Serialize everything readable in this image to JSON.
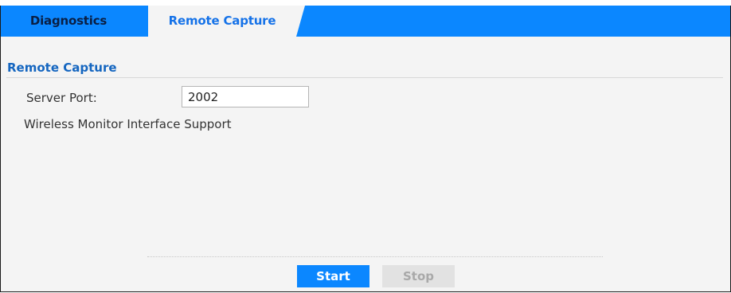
{
  "tabs": [
    {
      "label": "Diagnostics",
      "active": false
    },
    {
      "label": "Remote Capture",
      "active": true
    }
  ],
  "section": {
    "title": "Remote Capture"
  },
  "server_port": {
    "label": "Server Port:",
    "value": "2002"
  },
  "wireless_monitor": {
    "label": "Wireless Monitor Interface Support"
  },
  "buttons": {
    "start_label": "Start",
    "stop_label": "Stop"
  },
  "colors": {
    "accent": "#0b87ff",
    "section_title": "#1566c0",
    "panel_bg": "#f4f4f4"
  }
}
